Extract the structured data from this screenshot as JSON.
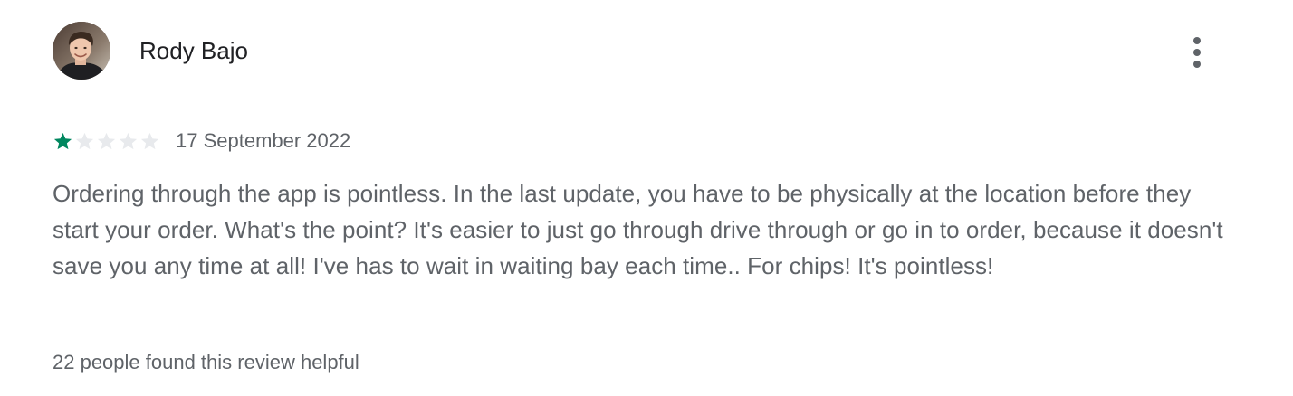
{
  "review": {
    "author": {
      "name": "Rody Bajo",
      "avatar_icon": "user-photo"
    },
    "more_options_icon": "more-vert-icon",
    "rating": {
      "value": 1,
      "max": 5,
      "filled_color": "#01875f",
      "empty_color": "#e8eaed"
    },
    "date": "17 September 2022",
    "text": "Ordering through the app is pointless. In the last update, you have to be physically at the location before they start your order. What's the point? It's easier to just go through drive through or go in to order, because it doesn't save you any time at all! I've has to wait in waiting bay each time.. For chips! It's pointless!",
    "helpful_text": "22 people found this review helpful"
  }
}
